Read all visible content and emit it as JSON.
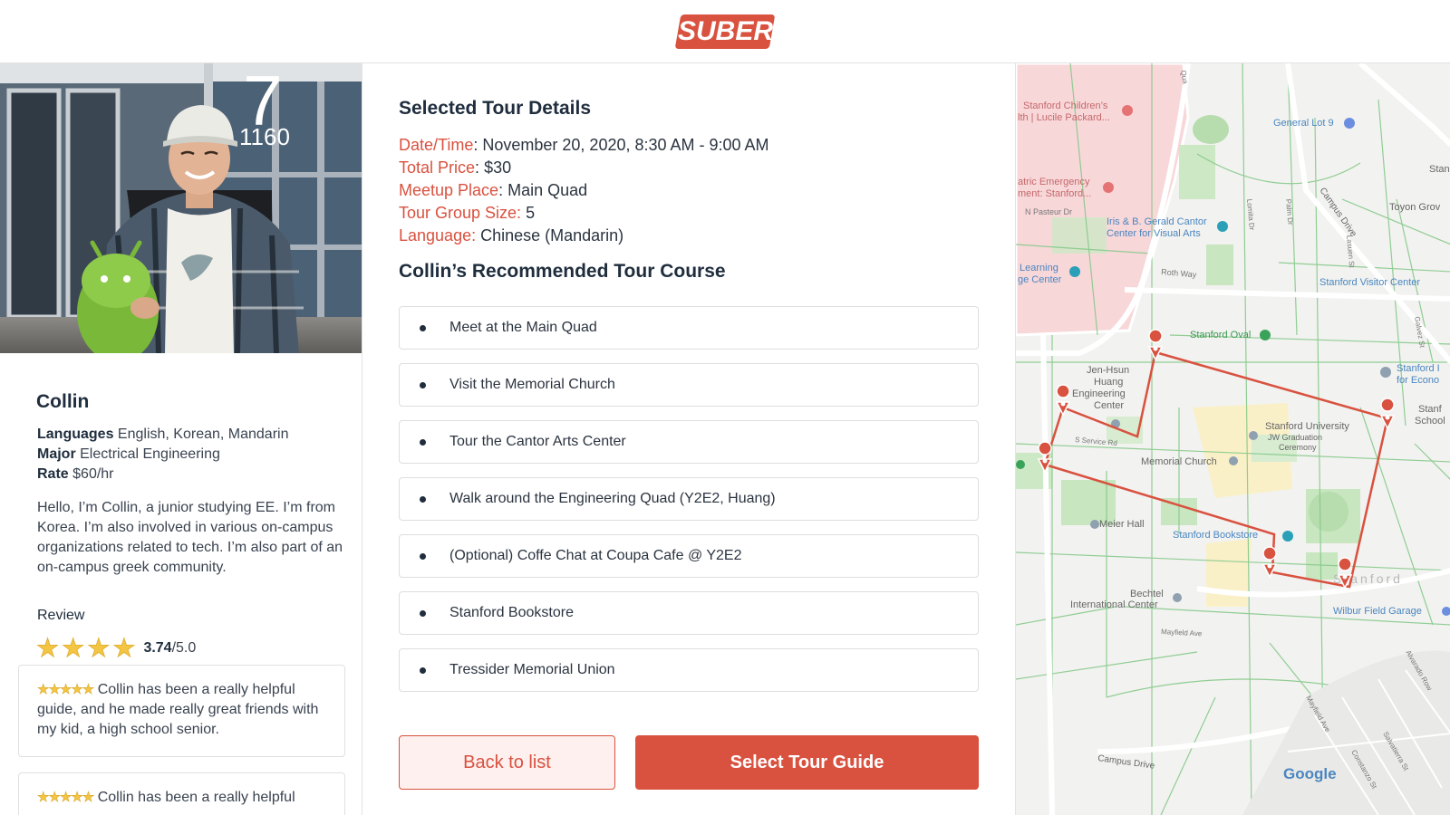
{
  "brand": {
    "logo_text": "SUBER",
    "accent": "#d9513f"
  },
  "photo": {
    "sign_number": "7",
    "sign_sub": "1160"
  },
  "guide": {
    "name": "Collin",
    "languages_label": "Languages",
    "languages": "English, Korean, Mandarin",
    "major_label": "Major",
    "major": "Electrical Engineering",
    "rate_label": "Rate",
    "rate": "$60/hr",
    "bio": "Hello, I’m Collin, a junior studying EE. I’m from Korea. I’m also involved in various on-campus organizations related to tech. I’m also part of an on-campus greek community."
  },
  "review": {
    "title": "Review",
    "stars": 4,
    "rating_value": "3.74",
    "rating_max": "/5.0",
    "cards": [
      {
        "stars": "★★★★★",
        "text": "Collin has been a really helpful guide, and he made really great friends with my kid, a high school senior."
      },
      {
        "stars": "★★★★★",
        "text": "Collin has been a really helpful"
      }
    ]
  },
  "details": {
    "title": "Selected Tour Details",
    "rows": [
      {
        "label": "Date/Time",
        "sep": ": ",
        "value": "November 20, 2020, 8:30 AM - 9:00 AM"
      },
      {
        "label": "Total Price",
        "sep": ": ",
        "value": "$30"
      },
      {
        "label": "Meetup Place",
        "sep": ": ",
        "value": "Main Quad"
      },
      {
        "label": "Tour Group Size:",
        "sep": " ",
        "value": "5"
      },
      {
        "label": "Language:",
        "sep": " ",
        "value": "Chinese (Mandarin)"
      }
    ]
  },
  "course": {
    "title": "Collin’s Recommended Tour Course",
    "items": [
      "Meet at the Main Quad",
      "Visit the Memorial Church",
      "Tour the Cantor Arts Center",
      "Walk around the Engineering Quad (Y2E2, Huang)",
      "(Optional) Coffe Chat at Coupa Cafe @ Y2E2",
      "Stanford Bookstore",
      "Tressider Memorial Union"
    ]
  },
  "actions": {
    "back_label": "Back to list",
    "select_label": "Select Tour Guide"
  },
  "map": {
    "labels": {
      "childrens": "Stanford Children’s",
      "packard": "lth | Lucile Packard...",
      "lot9": "General Lot 9",
      "stan": "Stan",
      "emergency1": "atric Emergency",
      "emergency2": "ment: Stanford...",
      "toyon": "Toyon Grov",
      "cantor1": "Iris & B. Gerald Cantor",
      "cantor2": "Center for Visual Arts",
      "learning1": "Learning",
      "learning2": "ge Center",
      "visitor": "Stanford Visitor Center",
      "oval": "Stanford Oval",
      "jenhsun1": "Jen-Hsun",
      "jenhsun2": "Huang",
      "jenhsun3": "Engineering",
      "jenhsun4": "Center",
      "stanford_in1": "Stanford I",
      "stanford_in2": "for Econo",
      "stanf_school1": "Stanf",
      "stanf_school2": "School",
      "university": "Stanford University",
      "graduation1": "JW Graduation",
      "graduation2": "Ceremony",
      "memorial": "Memorial Church",
      "meyer": "Meier Hall",
      "bookstore": "Stanford Bookstore",
      "stanford_watermark": "Stanford",
      "bechtel1": "Bechtel",
      "bechtel2": "International Center",
      "wilbur": "Wilbur Field Garage",
      "google": "Google",
      "street_pasteur": "N Pasteur Dr",
      "street_roth": "Roth Way",
      "street_campus": "Campus Drive",
      "street_service": "S Service Rd",
      "street_mayfield": "Mayfield Ave",
      "street_campus2": "Campus Drive",
      "street_lasuen": "Lasuen St",
      "street_palm": "Palm Dr",
      "street_lomita": "Lomita Dr",
      "street_galvez": "Galvez St",
      "street_alvarado": "Alvarado Row",
      "street_salvatierra": "Salvatierra St",
      "street_constanzo": "Constanzo St",
      "street_mayfield2": "Mayfield Ave",
      "street_quarry": "Qua"
    }
  }
}
